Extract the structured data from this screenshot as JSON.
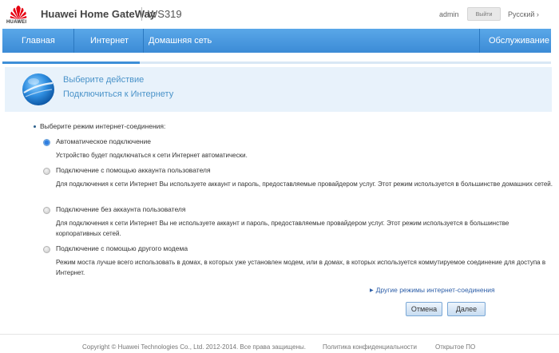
{
  "header": {
    "logo_text": "HUAWEI",
    "brand": "Huawei Home GateWay",
    "model": "WS319",
    "user": "admin",
    "logout_label": "Выйти",
    "language": "Русский ›"
  },
  "nav": {
    "items": [
      {
        "label": "Главная"
      },
      {
        "label": "Интернет"
      },
      {
        "label": "Домашняя сеть"
      },
      {
        "label": "Обслуживание"
      }
    ]
  },
  "wizard": {
    "progress_fraction": 0.25,
    "banner_line1": "Выберите действие",
    "banner_line2": "Подключиться к Интернету"
  },
  "form": {
    "prompt": "Выберите режим интернет-соединения:",
    "options": [
      {
        "title": "Автоматическое подключение",
        "desc": "Устройство будет подключаться к сети Интернет автоматически.",
        "selected": true
      },
      {
        "title": "Подключение с помощью аккаунта пользователя",
        "desc": "Для подключения к сети Интернет Вы используете аккаунт и пароль, предоставляемые провайдером услуг. Этот режим используется в большинстве домашних сетей.",
        "selected": false
      },
      {
        "title": "Подключение без аккаунта пользователя",
        "desc": "Для подключения к сети Интернет Вы не используете аккаунт и пароль, предоставляемые провайдером услуг. Этот режим используется в большинстве корпоративных сетей.",
        "selected": false
      },
      {
        "title": "Подключение с помощью другого модема",
        "desc": "Режим моста лучше всего использовать в домах, в которых уже установлен модем, или в домах, в которых используется коммутируемое соединение для доступа в Интернет.",
        "selected": false
      }
    ],
    "other_modes_link": "Другие режимы интернет-соединения",
    "cancel_label": "Отмена",
    "next_label": "Далее"
  },
  "footer": {
    "copyright": "Copyright © Huawei Technologies Co., Ltd. 2012-2014. Все права защищены.",
    "privacy": "Политика конфиденциальности",
    "open_source": "Открытое ПО"
  },
  "colors": {
    "nav_blue": "#3c8bd6",
    "banner_bg": "#e8f2fb",
    "banner_text": "#4a93c9",
    "link": "#2e5fa8",
    "brand_red": "#e60012"
  }
}
